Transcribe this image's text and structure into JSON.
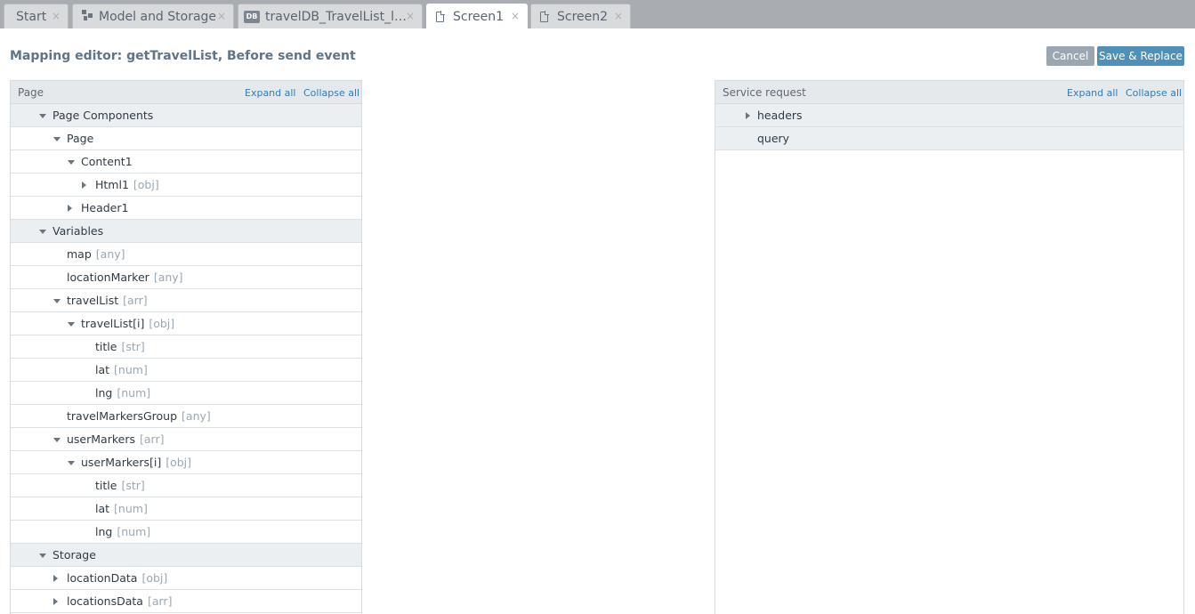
{
  "tabs": [
    {
      "label": "Start",
      "icon": "none"
    },
    {
      "label": "Model and Storage",
      "icon": "model-icon"
    },
    {
      "label": "travelDB_TravelList_li…",
      "icon": "db-icon",
      "badge": "DB"
    },
    {
      "label": "Screen1",
      "icon": "page-icon"
    },
    {
      "label": "Screen2",
      "icon": "page-icon"
    }
  ],
  "tab_close": "×",
  "header": {
    "title": "Mapping editor: getTravelList, Before send event",
    "cancel_label": "Cancel",
    "save_label": "Save & Replace"
  },
  "left_panel": {
    "title": "Page",
    "expand_all": "Expand all",
    "collapse_all": "Collapse all",
    "rows": [
      {
        "label": "Page Components",
        "type": "",
        "section": true
      },
      {
        "label": "Page",
        "type": ""
      },
      {
        "label": "Content1",
        "type": ""
      },
      {
        "label": "Html1",
        "type": "[obj]"
      },
      {
        "label": "Header1",
        "type": ""
      },
      {
        "label": "Variables",
        "type": "",
        "section": true
      },
      {
        "label": "map",
        "type": "[any]"
      },
      {
        "label": "locationMarker",
        "type": "[any]"
      },
      {
        "label": "travelList",
        "type": "[arr]"
      },
      {
        "label": "travelList[i]",
        "type": "[obj]"
      },
      {
        "label": "title",
        "type": "[str]"
      },
      {
        "label": "lat",
        "type": "[num]"
      },
      {
        "label": "lng",
        "type": "[num]"
      },
      {
        "label": "travelMarkersGroup",
        "type": "[any]"
      },
      {
        "label": "userMarkers",
        "type": "[arr]"
      },
      {
        "label": "userMarkers[i]",
        "type": "[obj]"
      },
      {
        "label": "title",
        "type": "[str]"
      },
      {
        "label": "lat",
        "type": "[num]"
      },
      {
        "label": "lng",
        "type": "[num]"
      },
      {
        "label": "Storage",
        "type": "",
        "section": true
      },
      {
        "label": "locationData",
        "type": "[obj]"
      },
      {
        "label": "locationsData",
        "type": "[arr]"
      }
    ]
  },
  "right_panel": {
    "title": "Service request",
    "expand_all": "Expand all",
    "collapse_all": "Collapse all",
    "rows": [
      {
        "label": "headers",
        "type": "",
        "section": true
      },
      {
        "label": "query",
        "type": "",
        "section": true
      }
    ]
  },
  "colors": {
    "accent": "#4f90b8",
    "link": "#2e7bbd",
    "title": "#5f7487",
    "type_hint": "#98a8b6"
  }
}
